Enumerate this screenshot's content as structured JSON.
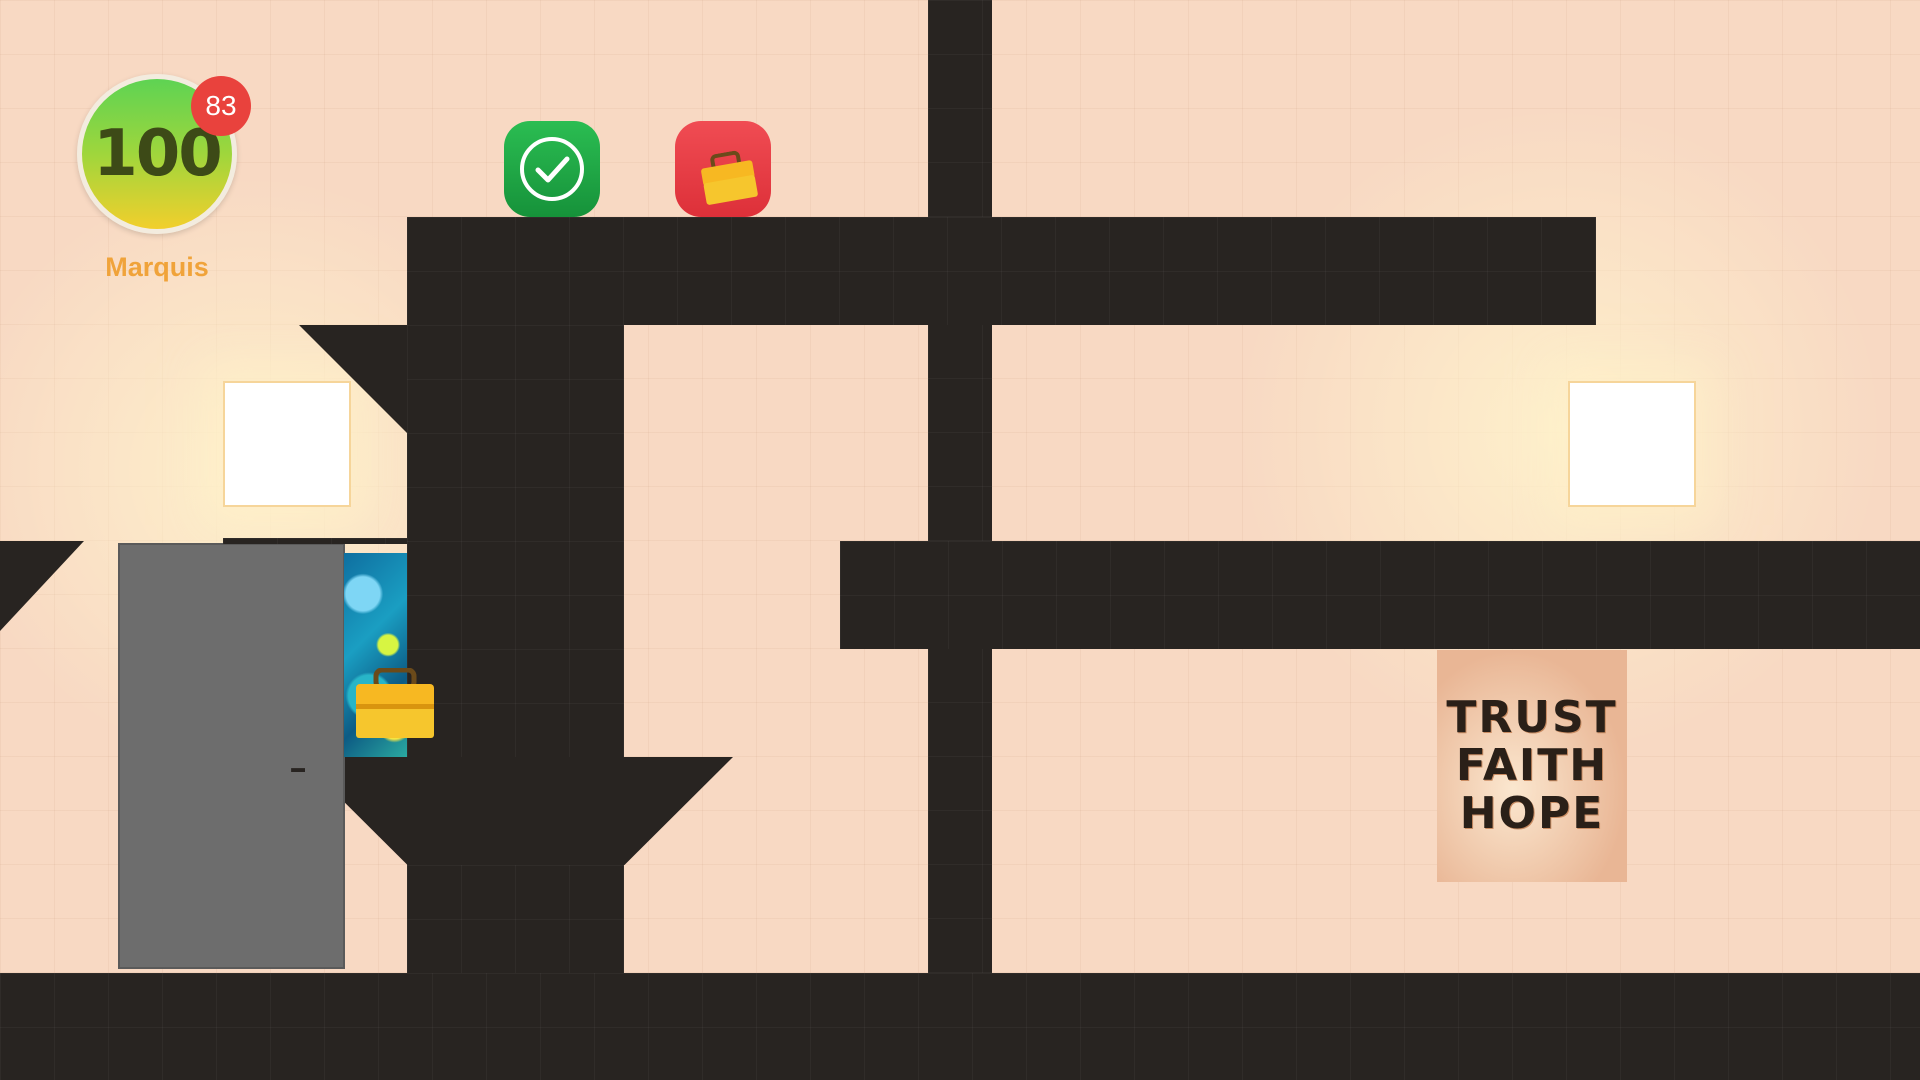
{
  "hud": {
    "score": "100",
    "notification_count": "83",
    "player_name": "Marquis",
    "colors": {
      "score_top": "#5ed353",
      "score_bottom": "#f2cf2c",
      "badge": "#e9423d",
      "name": "#f0a33a"
    }
  },
  "items": {
    "done_icon": "checkmark-icon",
    "toolbox_icon": "toolbox-icon"
  },
  "poster": {
    "lines": [
      "TRUST",
      "FAITH",
      "HOPE"
    ]
  },
  "colors": {
    "wall": "#282421",
    "background": "#f8d9c3",
    "door": "#6d6d6d",
    "done": "#1faa44",
    "toolbox_button": "#ea3f47"
  }
}
